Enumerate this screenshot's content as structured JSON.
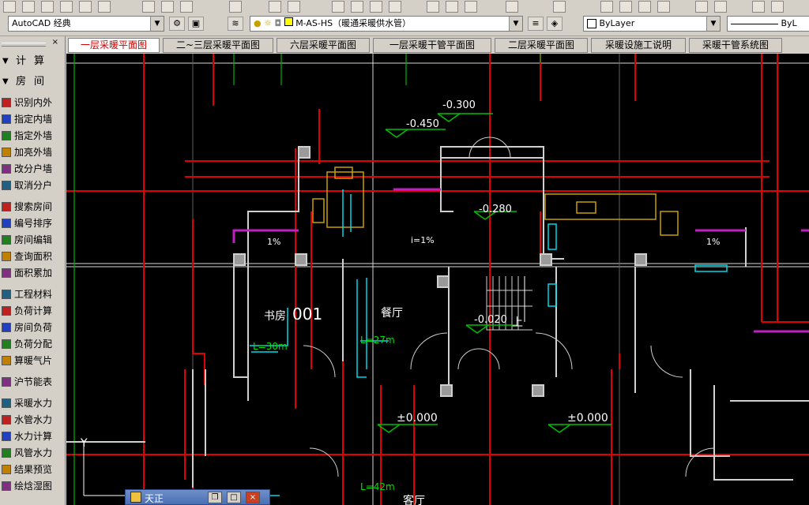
{
  "toolbar": {
    "workspace": "AutoCAD 经典",
    "layer_name": "M-AS-HS（暖通采暖供水管）",
    "color": "ByLayer",
    "linetype": "ByL"
  },
  "tabs": [
    {
      "label": "一层采暖平面图",
      "active": true
    },
    {
      "label": "二~三层采暖平面图",
      "active": false
    },
    {
      "label": "六层采暖平面图",
      "active": false
    },
    {
      "label": "一层采暖干管平面图",
      "active": false
    },
    {
      "label": "二层采暖平面图",
      "active": false
    },
    {
      "label": "采暖设施工说明",
      "active": false
    },
    {
      "label": "采暖干管系统图",
      "active": false
    }
  ],
  "sidebar": {
    "sections": [
      {
        "label": "计算",
        "top": true
      },
      {
        "label": "房间"
      }
    ],
    "items": [
      "识别内外",
      "指定内墙",
      "指定外墙",
      "加亮外墙",
      "改分户墙",
      "取消分户",
      "搜索房间",
      "编号排序",
      "房间编辑",
      "查询面积",
      "面积累加",
      "工程材料",
      "负荷计算",
      "房间负荷",
      "负荷分配",
      "算暖气片",
      "沪节能表",
      "采暖水力",
      "水管水力",
      "水力计算",
      "风管水力",
      "结果预览",
      "绘焓湿图"
    ]
  },
  "drawing": {
    "labels": {
      "elev1": "-0.300",
      "elev2": "-0.450",
      "elev3": "-0.280",
      "elev4": "-0.020",
      "elev5": "±0.000",
      "elev6": "±0.000",
      "room1": "书房",
      "room1_no": "001",
      "room2": "餐厅",
      "room3": "客厅",
      "len1": "L=30m",
      "len2": "L=27m",
      "len3": "L=42m",
      "up": "上",
      "slope1": "1%",
      "slope2": "i=1%",
      "slope3": "1%",
      "axis_y": "Y"
    }
  },
  "minimized_window": {
    "title": "天正"
  }
}
